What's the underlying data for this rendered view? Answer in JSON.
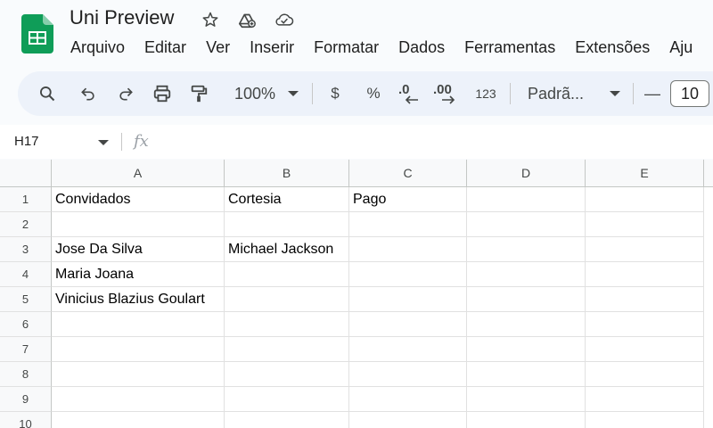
{
  "document": {
    "title": "Uni Preview"
  },
  "menubar": [
    "Arquivo",
    "Editar",
    "Ver",
    "Inserir",
    "Formatar",
    "Dados",
    "Ferramentas",
    "Extensões",
    "Aju"
  ],
  "toolbar": {
    "zoom": "100%",
    "currency": "$",
    "percent": "%",
    "decrease_decimals": ".0",
    "increase_decimals": ".00",
    "number_format": "123",
    "font": "Padrã...",
    "font_size_minus": "—",
    "font_size": "10"
  },
  "formula_bar": {
    "cell_ref": "H17",
    "fx": "fx",
    "value": ""
  },
  "columns": [
    "A",
    "B",
    "C",
    "D",
    "E"
  ],
  "rows": [
    {
      "num": "1",
      "cells": [
        "Convidados",
        "Cortesia",
        "Pago",
        "",
        ""
      ]
    },
    {
      "num": "2",
      "cells": [
        "",
        "",
        "",
        "",
        ""
      ]
    },
    {
      "num": "3",
      "cells": [
        "Jose Da Silva",
        "Michael Jackson",
        "",
        "",
        ""
      ]
    },
    {
      "num": "4",
      "cells": [
        "Maria Joana",
        "",
        "",
        "",
        ""
      ]
    },
    {
      "num": "5",
      "cells": [
        "Vinicius Blazius Goulart",
        "",
        "",
        "",
        ""
      ]
    },
    {
      "num": "6",
      "cells": [
        "",
        "",
        "",
        "",
        ""
      ]
    },
    {
      "num": "7",
      "cells": [
        "",
        "",
        "",
        "",
        ""
      ]
    },
    {
      "num": "8",
      "cells": [
        "",
        "",
        "",
        "",
        ""
      ]
    },
    {
      "num": "9",
      "cells": [
        "",
        "",
        "",
        "",
        ""
      ]
    },
    {
      "num": "10",
      "cells": [
        "",
        "",
        "",
        "",
        ""
      ]
    }
  ],
  "colors": {
    "logo": "#0f9d58",
    "toolbar_bg": "#edf2fa",
    "header_bg": "#f8f9fa",
    "grid_line": "#e1e1e1"
  }
}
